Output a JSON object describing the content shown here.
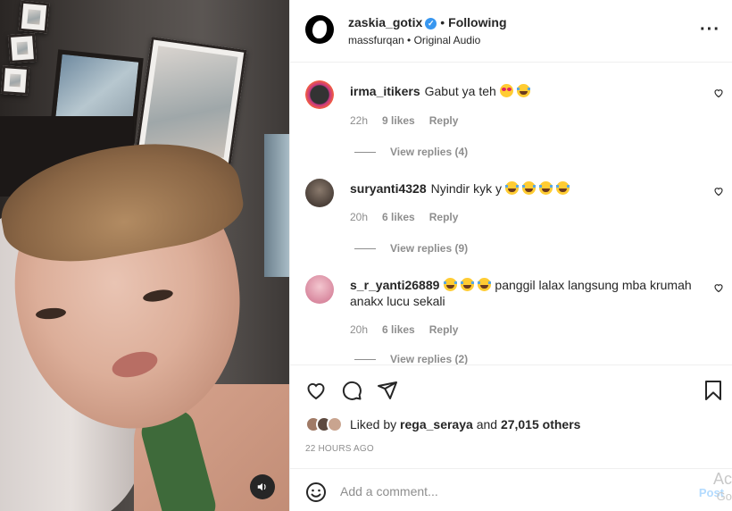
{
  "post": {
    "username": "zaskia_gotix",
    "separator": "•",
    "follow_status": "Following",
    "audio_owner": "massfurqan",
    "audio_separator": "•",
    "audio_label": "Original Audio",
    "more_icon": "more-horizontal-icon",
    "verified_icon": "verified-badge-icon"
  },
  "comments": [
    {
      "username": "irma_itikers",
      "text": "Gabut ya teh",
      "emojis": [
        "heart-eyes",
        "laugh"
      ],
      "time": "22h",
      "likes": "9 likes",
      "reply_label": "Reply",
      "view_replies": "View replies (4)"
    },
    {
      "username": "suryanti4328",
      "text": "Nyindir kyk y",
      "emojis": [
        "laugh",
        "laugh",
        "laugh",
        "laugh"
      ],
      "time": "20h",
      "likes": "6 likes",
      "reply_label": "Reply",
      "view_replies": "View replies (9)"
    },
    {
      "username": "s_r_yanti26889",
      "text": "panggil lalax langsung mba krumah anakx lucu sekali",
      "emojis_before": [
        "laugh",
        "laugh",
        "laugh"
      ],
      "time": "20h",
      "likes": "6 likes",
      "reply_label": "Reply",
      "view_replies": "View replies (2)"
    }
  ],
  "actions": {
    "like_icon": "heart-icon",
    "comment_icon": "comment-icon",
    "share_icon": "send-icon",
    "save_icon": "bookmark-icon"
  },
  "likes": {
    "prefix": "Liked by",
    "user": "rega_seraya",
    "conjunction": "and",
    "others": "27,015 others"
  },
  "timestamp": "22 HOURS AGO",
  "composer": {
    "placeholder": "Add a comment...",
    "post_label": "Post"
  },
  "overlay": {
    "line1": "Ac",
    "line2": "Go"
  },
  "colors": {
    "accent": "#0095f6",
    "post_disabled": "#b3dbff",
    "muted": "#8e8e8e",
    "verified": "#3897f0"
  }
}
